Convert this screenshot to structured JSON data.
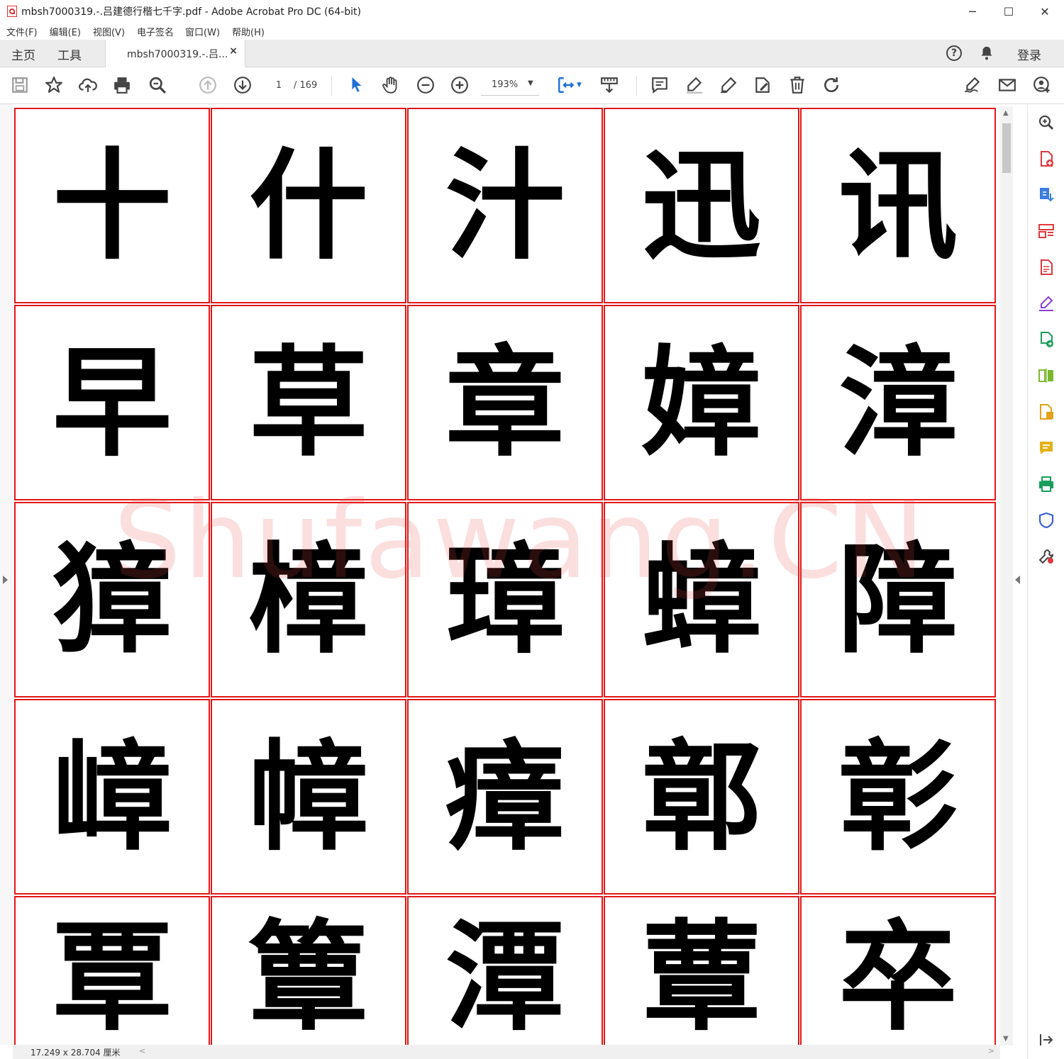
{
  "window": {
    "title": "mbsh7000319.-.吕建德行楷七千字.pdf - Adobe Acrobat Pro DC (64-bit)",
    "minimize": "─",
    "maximize": "☐",
    "close": "✕"
  },
  "menu": [
    "文件(F)",
    "编辑(E)",
    "视图(V)",
    "电子签名",
    "窗口(W)",
    "帮助(H)"
  ],
  "tabs": {
    "home": "主页",
    "tools": "工具",
    "document": "mbsh7000319.-.吕...",
    "close": "×",
    "login": "登录",
    "help": "?"
  },
  "toolbar": {
    "page_current": "1",
    "page_total": "/ 169",
    "zoom": "193%"
  },
  "document": {
    "watermark": "Shufawang.CN",
    "characters": [
      "十",
      "什",
      "汁",
      "迅",
      "讯",
      "早",
      "草",
      "章",
      "嫜",
      "漳",
      "獐",
      "樟",
      "璋",
      "蟑",
      "障",
      "嶂",
      "幛",
      "瘴",
      "鄣",
      "彰",
      "覃",
      "簟",
      "潭",
      "蕈",
      "卒"
    ]
  },
  "status": {
    "page_size": "17.249 x 28.704 厘米"
  },
  "colors": {
    "grid_red": "#e21818",
    "accent_blue": "#1f6fd6",
    "watermark": "#eb4646"
  }
}
